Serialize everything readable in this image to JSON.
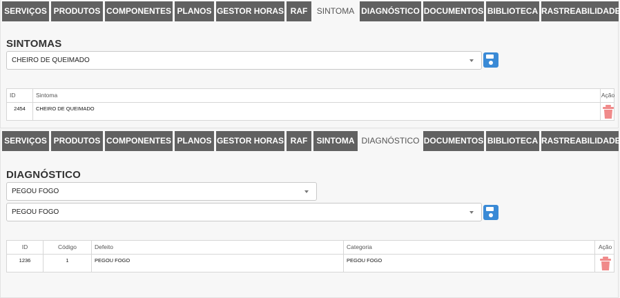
{
  "tabs": [
    "SERVIÇOS",
    "PRODUTOS",
    "COMPONENTES",
    "PLANOS",
    "GESTOR HORAS",
    "RAF",
    "SINTOMA",
    "DIAGNÓSTICO",
    "DOCUMENTOS",
    "BIBLIOTECA",
    "RASTREABILIDADE"
  ],
  "sintoma_panel": {
    "active_tab": "SINTOMA",
    "title": "SINTOMAS",
    "select_value": "CHEIRO DE QUEIMADO",
    "table": {
      "headers": {
        "id": "ID",
        "sintoma": "Sintoma",
        "acao": "Ação"
      },
      "rows": [
        {
          "id": "2454",
          "sintoma": "CHEIRO DE QUEIMADO"
        }
      ]
    }
  },
  "diagnostico_panel": {
    "active_tab": "DIAGNÓSTICO",
    "title": "DIAGNÓSTICO",
    "select1_value": "PEGOU FOGO",
    "select2_value": "PEGOU FOGO",
    "table": {
      "headers": {
        "id": "ID",
        "codigo": "Código",
        "defeito": "Defeito",
        "categoria": "Categoria",
        "acao": "Ação"
      },
      "rows": [
        {
          "id": "1236",
          "codigo": "1",
          "defeito": "PEGOU FOGO",
          "categoria": "PEGOU FOGO"
        }
      ]
    }
  },
  "icons": {
    "save": "floppy-disk-icon",
    "delete": "trash-icon"
  },
  "colors": {
    "tab_bg": "#616161",
    "tab_text": "#ffffff",
    "save_icon": "#3a8ad6",
    "trash_icon": "#f08a8a"
  }
}
